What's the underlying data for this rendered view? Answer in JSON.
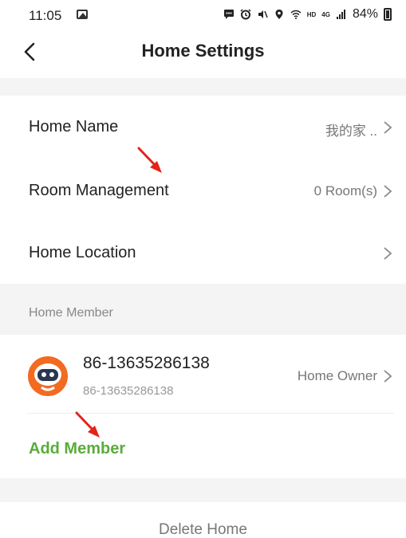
{
  "status_bar": {
    "time": "11:05",
    "hd": "HD",
    "network": "4G",
    "battery": "84%",
    "icons": [
      "photo-icon",
      "message-icon",
      "alarm-icon",
      "mute-icon",
      "location-icon",
      "wifi-icon",
      "signal-icon",
      "battery-icon"
    ]
  },
  "header": {
    "title": "Home Settings",
    "back_icon": "chevron-left-icon"
  },
  "settings": {
    "home_name": {
      "label": "Home Name",
      "value": "我的家 .."
    },
    "room_management": {
      "label": "Room Management",
      "value": "0 Room(s)"
    },
    "home_location": {
      "label": "Home Location",
      "value": ""
    }
  },
  "members": {
    "section_label": "Home Member",
    "items": [
      {
        "name": "86-13635286138",
        "account": "86-13635286138",
        "role": "Home Owner"
      }
    ],
    "add_label": "Add Member"
  },
  "footer": {
    "delete_label": "Delete Home"
  },
  "colors": {
    "accent_green": "#5aac3a",
    "annotation_red": "#e3241b",
    "avatar_orange": "#f26b21",
    "band_gray": "#f4f4f4"
  }
}
